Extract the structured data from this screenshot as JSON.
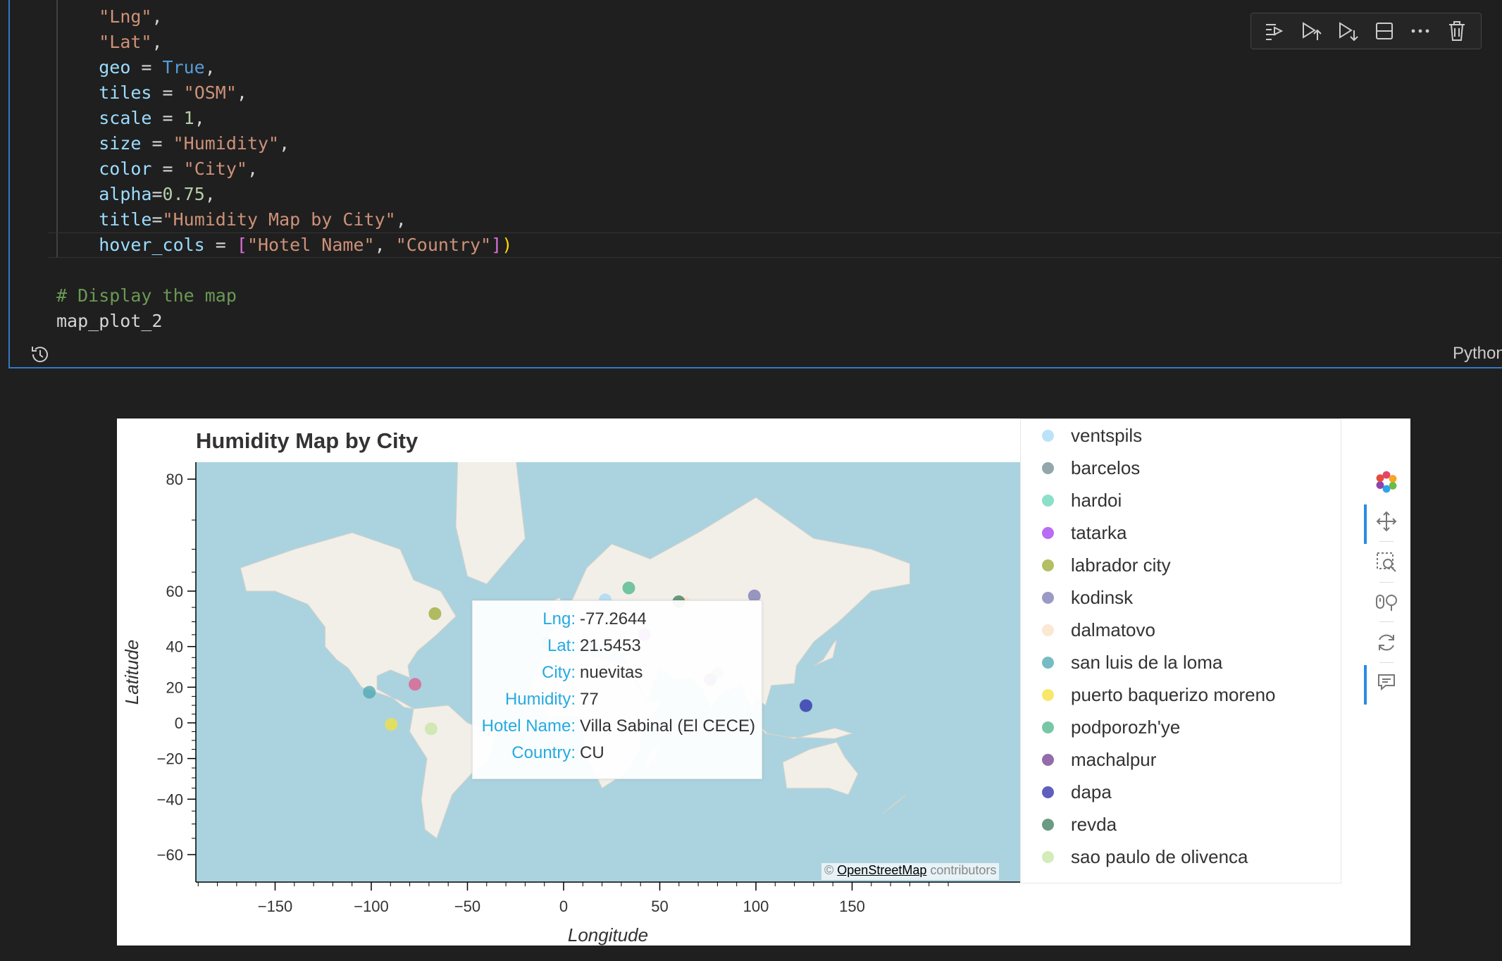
{
  "editor": {
    "code_lines": [
      {
        "segments": [
          {
            "t": "    "
          },
          {
            "t": "\"Lng\"",
            "c": "str"
          },
          {
            "t": ","
          }
        ]
      },
      {
        "segments": [
          {
            "t": "    "
          },
          {
            "t": "\"Lat\"",
            "c": "str"
          },
          {
            "t": ","
          }
        ]
      },
      {
        "segments": [
          {
            "t": "    "
          },
          {
            "t": "geo",
            "c": "var"
          },
          {
            "t": " = "
          },
          {
            "t": "True",
            "c": "kw"
          },
          {
            "t": ","
          }
        ]
      },
      {
        "segments": [
          {
            "t": "    "
          },
          {
            "t": "tiles",
            "c": "var"
          },
          {
            "t": " = "
          },
          {
            "t": "\"OSM\"",
            "c": "str"
          },
          {
            "t": ","
          }
        ]
      },
      {
        "segments": [
          {
            "t": "    "
          },
          {
            "t": "scale",
            "c": "var"
          },
          {
            "t": " = "
          },
          {
            "t": "1",
            "c": "num"
          },
          {
            "t": ","
          }
        ]
      },
      {
        "segments": [
          {
            "t": "    "
          },
          {
            "t": "size",
            "c": "var"
          },
          {
            "t": " = "
          },
          {
            "t": "\"Humidity\"",
            "c": "str"
          },
          {
            "t": ","
          }
        ]
      },
      {
        "segments": [
          {
            "t": "    "
          },
          {
            "t": "color",
            "c": "var"
          },
          {
            "t": " = "
          },
          {
            "t": "\"City\"",
            "c": "str"
          },
          {
            "t": ","
          }
        ]
      },
      {
        "segments": [
          {
            "t": "    "
          },
          {
            "t": "alpha",
            "c": "var"
          },
          {
            "t": "="
          },
          {
            "t": "0.75",
            "c": "num"
          },
          {
            "t": ","
          }
        ]
      },
      {
        "segments": [
          {
            "t": "    "
          },
          {
            "t": "title",
            "c": "var"
          },
          {
            "t": "="
          },
          {
            "t": "\"Humidity Map by City\"",
            "c": "str"
          },
          {
            "t": ","
          }
        ]
      },
      {
        "segments": [
          {
            "t": "    "
          },
          {
            "t": "hover_cols",
            "c": "var"
          },
          {
            "t": " = "
          },
          {
            "t": "[",
            "c": "br"
          },
          {
            "t": "\"Hotel Name\"",
            "c": "str"
          },
          {
            "t": ", "
          },
          {
            "t": "\"Country\"",
            "c": "str"
          },
          {
            "t": "]",
            "c": "br"
          },
          {
            "t": ")",
            "c": "br2"
          }
        ]
      },
      {
        "segments": [
          {
            "t": ""
          }
        ]
      },
      {
        "segments": [
          {
            "t": "# Display the map",
            "c": "cmt"
          }
        ]
      },
      {
        "segments": [
          {
            "t": "map_plot_2"
          }
        ]
      }
    ],
    "language": "Python"
  },
  "toolbar": {
    "icons": [
      "run-by-line-icon",
      "execute-above-icon",
      "execute-below-icon",
      "split-cell-icon",
      "more-actions-icon",
      "delete-cell-icon"
    ]
  },
  "plot": {
    "title": "Humidity Map by City",
    "attribution_symbol": "©",
    "attribution_link": "OpenStreetMap",
    "attribution_suffix": " contributors"
  },
  "chart_data": {
    "type": "scatter",
    "title": "Humidity Map by City",
    "xlabel": "Longitude",
    "ylabel": "Latitude",
    "x_ticks": [
      -150,
      -100,
      -50,
      0,
      50,
      100,
      150
    ],
    "y_ticks": [
      80,
      60,
      40,
      20,
      0,
      -20,
      -40,
      -60
    ],
    "xlim": [
      -212,
      212
    ],
    "ylim": [
      -62,
      82
    ],
    "grid": false,
    "legend_position": "right",
    "y_scale": "web-mercator",
    "series": [
      {
        "name": "ventspils",
        "color": "#a6d8f5",
        "points": [
          [
            21.6,
            57.4
          ]
        ]
      },
      {
        "name": "barcelos",
        "color": "#6e8890",
        "points": [
          [
            -8.6,
            41.5
          ]
        ]
      },
      {
        "name": "hardoi",
        "color": "#66d6b8",
        "points": [
          [
            80.1,
            27.4
          ]
        ]
      },
      {
        "name": "tatarka",
        "color": "#a23cf0",
        "points": [
          [
            42.0,
            45.0
          ]
        ]
      },
      {
        "name": "labrador city",
        "color": "#9aa832",
        "points": [
          [
            -66.9,
            52.9
          ]
        ]
      },
      {
        "name": "kodinsk",
        "color": "#7a78b0",
        "points": [
          [
            99.2,
            58.6
          ]
        ]
      },
      {
        "name": "dalmatovo",
        "color": "#f8e0c4",
        "points": [
          [
            62.9,
            56.3
          ]
        ]
      },
      {
        "name": "san luis de la loma",
        "color": "#4aa6b0",
        "points": [
          [
            -101.0,
            17.3
          ]
        ]
      },
      {
        "name": "puerto baquerizo moreno",
        "color": "#f4e03a",
        "points": [
          [
            -89.6,
            -0.9
          ]
        ]
      },
      {
        "name": "podporozh'ye",
        "color": "#4ab48a",
        "points": [
          [
            33.9,
            60.9
          ]
        ]
      },
      {
        "name": "machalpur",
        "color": "#6e3c8c",
        "points": [
          [
            76.3,
            24.1
          ]
        ]
      },
      {
        "name": "dapa",
        "color": "#2a2aa8",
        "points": [
          [
            126.0,
            9.8
          ]
        ]
      },
      {
        "name": "revda",
        "color": "#3a7a5a",
        "points": [
          [
            59.9,
            56.8
          ]
        ]
      },
      {
        "name": "sao paulo de olivenca",
        "color": "#c4e6a0",
        "points": [
          [
            -68.9,
            -3.4
          ]
        ]
      },
      {
        "name": "nuevitas",
        "color": "#e05a8a",
        "points": [
          [
            -77.2644,
            21.5453
          ]
        ]
      }
    ]
  },
  "legend": {
    "items": [
      {
        "label": "ventspils",
        "color": "#a6d8f5"
      },
      {
        "label": "barcelos",
        "color": "#6e8890"
      },
      {
        "label": "hardoi",
        "color": "#66d6b8"
      },
      {
        "label": "tatarka",
        "color": "#a23cf0"
      },
      {
        "label": "labrador city",
        "color": "#9aa832"
      },
      {
        "label": "kodinsk",
        "color": "#7a78b0"
      },
      {
        "label": "dalmatovo",
        "color": "#f8e0c4"
      },
      {
        "label": "san luis de la loma",
        "color": "#4aa6b0"
      },
      {
        "label": "puerto baquerizo moreno",
        "color": "#f4e03a"
      },
      {
        "label": "podporozh'ye",
        "color": "#4ab48a"
      },
      {
        "label": "machalpur",
        "color": "#6e3c8c"
      },
      {
        "label": "dapa",
        "color": "#2a2aa8"
      },
      {
        "label": "revda",
        "color": "#3a7a5a"
      },
      {
        "label": "sao paulo de olivenca",
        "color": "#c4e6a0"
      }
    ]
  },
  "tooltip": {
    "rows": [
      {
        "key": "Lng:",
        "value": "-77.2644"
      },
      {
        "key": "Lat:",
        "value": "21.5453"
      },
      {
        "key": "City:",
        "value": "nuevitas"
      },
      {
        "key": "Humidity:",
        "value": "77"
      },
      {
        "key": "Hotel Name:",
        "value": "Villa Sabinal (El CECE)"
      },
      {
        "key": "Country:",
        "value": "CU"
      }
    ]
  },
  "plot_tools": [
    {
      "name": "bokeh-logo-icon"
    },
    {
      "name": "pan-tool-icon",
      "active": true
    },
    {
      "name": "box-zoom-tool-icon"
    },
    {
      "name": "wheel-zoom-tool-icon"
    },
    {
      "name": "reset-tool-icon"
    },
    {
      "name": "hover-tool-icon",
      "active": true
    }
  ],
  "colors": {
    "map_water": "#aad3df",
    "map_land": "#f2efe9",
    "tooltip_key": "#26aae1",
    "cell_border": "#3478c6"
  }
}
